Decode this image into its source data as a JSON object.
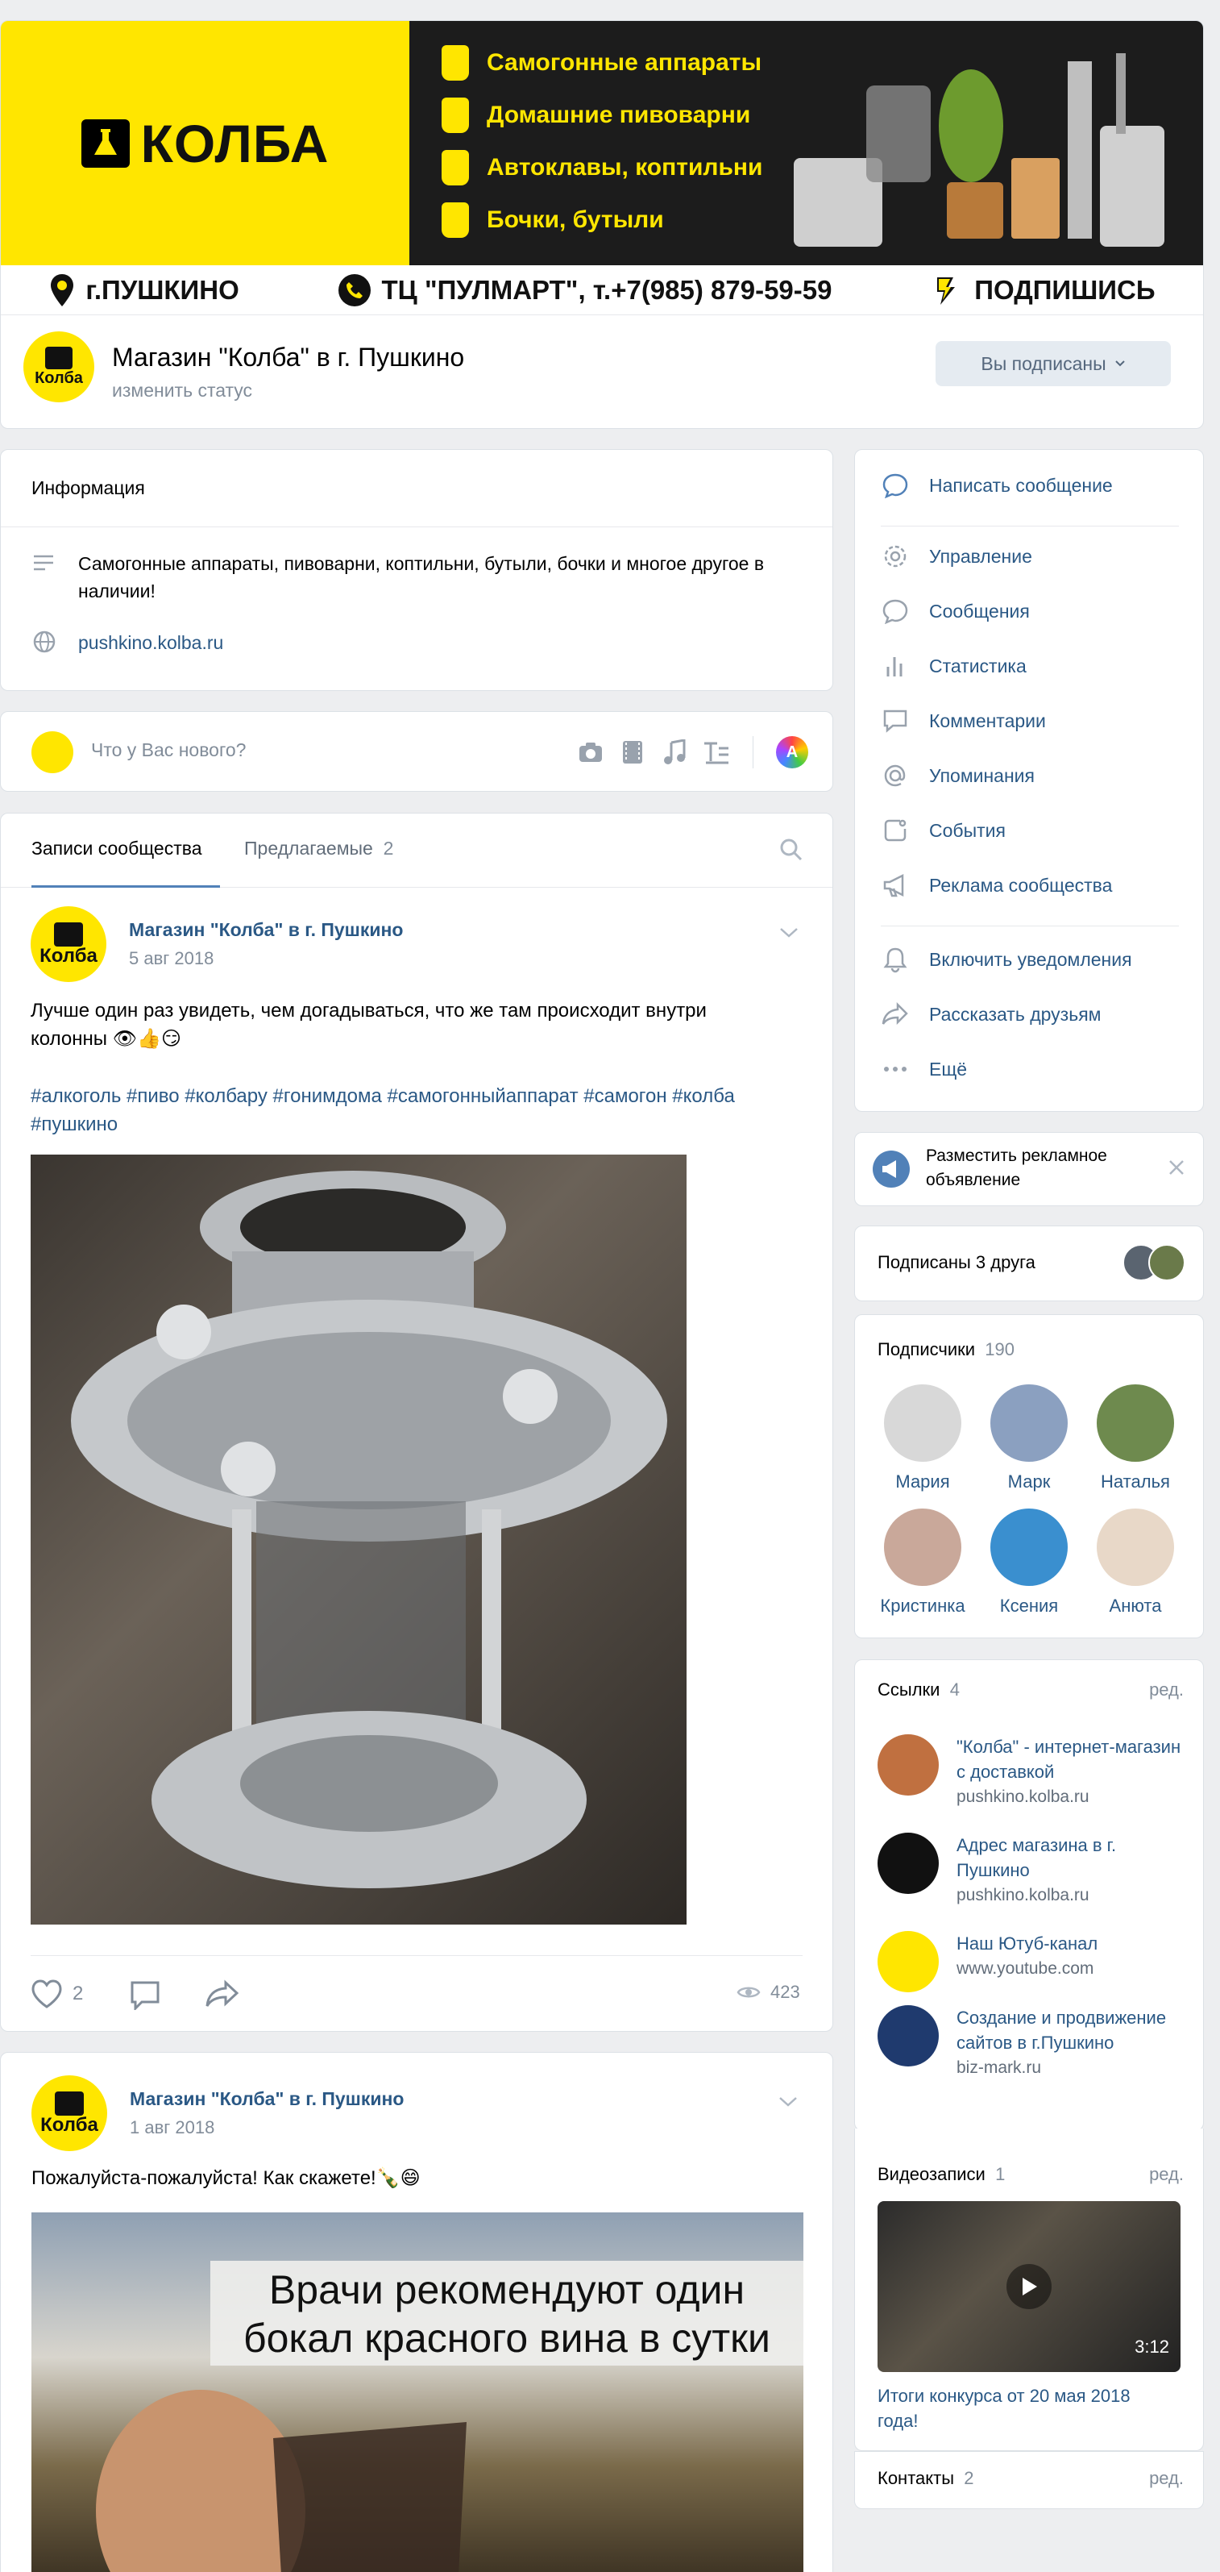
{
  "banner": {
    "logo_text": "КОЛБА",
    "lines": [
      "Самогонные аппараты",
      "Домашние пивоварни",
      "Автоклавы, коптильни",
      "Бочки, бутыли"
    ],
    "city": "г.ПУШКИНО",
    "contact": "ТЦ \"ПУЛМАРТ\", т.+7(985) 879-59-59",
    "subscribe_cta": "ПОДПИШИСЬ"
  },
  "header": {
    "avatar_text": "Колба",
    "title": "Магазин \"Колба\" в г. Пушкино",
    "status": "изменить статус",
    "subscribe_button": "Вы подписаны"
  },
  "info": {
    "title": "Информация",
    "description": "Самогонные аппараты, пивоварни, коптильни, бутыли, бочки и многое другое в наличии!",
    "website": "pushkino.kolba.ru"
  },
  "composer": {
    "placeholder": "Что у Вас нового?",
    "avatar_text": "Колба",
    "round_button": "A"
  },
  "wall": {
    "tab_posts": "Записи сообщества",
    "tab_suggested": "Предлагаемые",
    "suggested_count": "2"
  },
  "posts": [
    {
      "author": "Магазин \"Колба\" в г. Пушкино",
      "date": "5 авг 2018",
      "avatar_text": "Колба",
      "text": "Лучше один раз увидеть, чем догадываться, что же там происходит внутри колонны 👁👍😏",
      "tags": "#алкоголь #пиво #колбару #гонимдома #самогонныйаппарат #самогон #колба #пушкино",
      "likes": "2",
      "views": "423"
    },
    {
      "author": "Магазин \"Колба\" в г. Пушкино",
      "date": "1 авг 2018",
      "avatar_text": "Колба",
      "text": "Пожалуйста-пожалуйста! Как скажете!🍾😄",
      "image_caption": "Врачи рекомендуют один бокал красного вина в сутки"
    }
  ],
  "menu": {
    "write_message": "Написать сообщение",
    "items": [
      "Управление",
      "Сообщения",
      "Статистика",
      "Комментарии",
      "Упоминания",
      "События",
      "Реклама сообщества"
    ],
    "items2": [
      "Включить уведомления",
      "Рассказать друзьям",
      "Ещё"
    ]
  },
  "ad": {
    "text": "Разместить рекламное объявление"
  },
  "friends": {
    "text": "Подписаны 3 друга"
  },
  "subscribers": {
    "title": "Подписчики",
    "count": "190",
    "people": [
      "Мария",
      "Марк",
      "Наталья",
      "Кристинка",
      "Ксения",
      "Анюта"
    ]
  },
  "links": {
    "title": "Ссылки",
    "count": "4",
    "edit": "ред.",
    "items": [
      {
        "title": "\"Колба\" - интернет-магазин с доставкой",
        "url": "pushkino.kolba.ru"
      },
      {
        "title": "Адрес магазина в г. Пушкино",
        "url": "pushkino.kolba.ru"
      },
      {
        "title": "Наш Ютуб-канал",
        "url": "www.youtube.com"
      },
      {
        "title": "Создание и продвижение сайтов в г.Пушкино",
        "url": "biz-mark.ru"
      }
    ]
  },
  "videos": {
    "title": "Видеозаписи",
    "count": "1",
    "edit": "ред.",
    "duration": "3:12",
    "video_title": "Итоги конкурса от 20 мая 2018 года!"
  },
  "contacts": {
    "title": "Контакты",
    "count": "2",
    "edit": "ред."
  },
  "colors": {
    "brand_yellow": "#ffe600",
    "link": "#2a5885",
    "accent": "#5181b8",
    "page_bg": "#edeef0"
  }
}
